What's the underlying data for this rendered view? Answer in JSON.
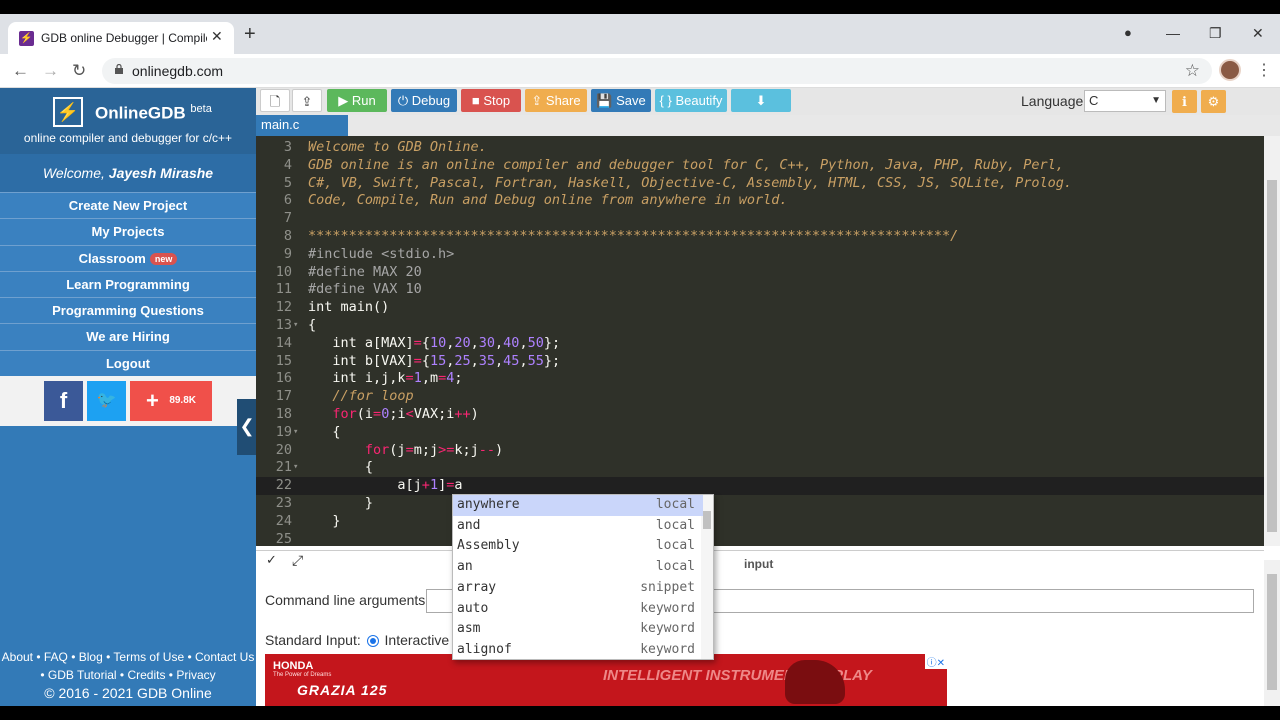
{
  "browser": {
    "tab_title": "GDB online Debugger | Compiler - Code, Compile, Run, Debug online C, C++",
    "tab_favicon": "⚡",
    "tab_close": "✕",
    "new_tab": "+",
    "url": "onlinegdb.com",
    "nav": {
      "back": "←",
      "forward": "→",
      "reload": "↻"
    },
    "window": {
      "profile": "●",
      "minimize": "—",
      "restore": "❐",
      "close": "✕"
    },
    "bookmark": "☆",
    "menu": "⋮"
  },
  "sidebar": {
    "logo_icon": "⚡",
    "brand": "OnlineGDB",
    "beta": "beta",
    "tagline": "online compiler and debugger for c/c++",
    "welcome_prefix": "Welcome, ",
    "user": "Jayesh Mirashe",
    "items": [
      {
        "label": "Create New Project"
      },
      {
        "label": "My Projects"
      },
      {
        "label": "Classroom",
        "badge": "new"
      },
      {
        "label": "Learn Programming"
      },
      {
        "label": "Programming Questions"
      },
      {
        "label": "We are Hiring"
      },
      {
        "label": "Logout"
      }
    ],
    "social": {
      "facebook": "f",
      "twitter": "🐦",
      "share_plus": "+",
      "share_count": "89.8K"
    },
    "footer_line1": "About • FAQ • Blog • Terms of Use • Contact Us",
    "footer_line2": "• GDB Tutorial • Credits • Privacy",
    "footer_copy": "© 2016 - 2021 GDB Online",
    "collapse": "❮"
  },
  "toolbar": {
    "new_file": "🗋",
    "upload": "⇪",
    "run": "▶ Run",
    "debug": "⏻ Debug",
    "stop": "■ Stop",
    "share": "⇪ Share",
    "save": "💾 Save",
    "beautify": "{ } Beautify",
    "download": "⬇",
    "language_label": "Language",
    "language_value": "C",
    "info": "ℹ",
    "settings": "⚙",
    "colors": {
      "run": "#5cb85c",
      "debug": "#337ab7",
      "stop": "#d9534f",
      "share": "#f0ad4e",
      "save": "#337ab7",
      "beautify": "#5bc0de",
      "download": "#5bc0de"
    }
  },
  "file_tab": "main.c",
  "editor": {
    "lines": [
      {
        "n": "3",
        "html": "<span class='c'>Welcome to GDB Online.</span>"
      },
      {
        "n": "4",
        "html": "<span class='c'>GDB online is an online compiler and debugger tool for C, C++, Python, Java, PHP, Ruby, Perl,</span>"
      },
      {
        "n": "5",
        "html": "<span class='c'>C#, VB, Swift, Pascal, Fortran, Haskell, Objective-C, Assembly, HTML, CSS, JS, SQLite, Prolog.</span>"
      },
      {
        "n": "6",
        "html": "<span class='c'>Code, Compile, Run and Debug online from anywhere in world.</span>"
      },
      {
        "n": "7",
        "html": ""
      },
      {
        "n": "8",
        "html": "<span class='c'>*******************************************************************************/</span>"
      },
      {
        "n": "9",
        "html": "<span class='pp'>#include &lt;stdio.h&gt;</span>"
      },
      {
        "n": "10",
        "html": "<span class='pp'>#define MAX 20</span>"
      },
      {
        "n": "11",
        "html": "<span class='pp'>#define VAX 10</span>"
      },
      {
        "n": "12",
        "html": "int main()"
      },
      {
        "n": "13",
        "fold": true,
        "html": "{"
      },
      {
        "n": "14",
        "html": "   int a[MAX]<span class='op'>=</span>{<span class='n'>10</span>,<span class='n'>20</span>,<span class='n'>30</span>,<span class='n'>40</span>,<span class='n'>50</span>};"
      },
      {
        "n": "15",
        "html": "   int b[VAX]<span class='op'>=</span>{<span class='n'>15</span>,<span class='n'>25</span>,<span class='n'>35</span>,<span class='n'>45</span>,<span class='n'>55</span>};"
      },
      {
        "n": "16",
        "html": "   int i,j,k<span class='op'>=</span><span class='n'>1</span>,m<span class='op'>=</span><span class='n'>4</span>;"
      },
      {
        "n": "17",
        "html": "   <span class='c'>//for loop</span>"
      },
      {
        "n": "18",
        "html": "   <span class='loopkw'>for</span>(i<span class='op'>=</span><span class='n'>0</span>;i<span class='op'>&lt;</span>VAX;i<span class='op'>++</span>)"
      },
      {
        "n": "19",
        "fold": true,
        "html": "   {"
      },
      {
        "n": "20",
        "html": "       <span class='loopkw'>for</span>(j<span class='op'>=</span>m;j<span class='op'>&gt;=</span>k;j<span class='op'>--</span>)"
      },
      {
        "n": "21",
        "fold": true,
        "html": "       {"
      },
      {
        "n": "22",
        "active": true,
        "html": "           a[j<span class='op'>+</span><span class='n'>1</span>]<span class='op'>=</span>a"
      },
      {
        "n": "23",
        "html": "       }"
      },
      {
        "n": "24",
        "html": "   }"
      },
      {
        "n": "25",
        "html": ""
      }
    ]
  },
  "autocomplete": [
    {
      "word": "anywhere",
      "meta": "local",
      "selected": true
    },
    {
      "word": "and",
      "meta": "local"
    },
    {
      "word": "Assembly",
      "meta": "local"
    },
    {
      "word": "an",
      "meta": "local"
    },
    {
      "word": "array",
      "meta": "snippet"
    },
    {
      "word": "auto",
      "meta": "keyword"
    },
    {
      "word": "asm",
      "meta": "keyword"
    },
    {
      "word": "alignof",
      "meta": "keyword"
    }
  ],
  "bottom": {
    "collapse_icon": "✓",
    "expand_icon": "⤢",
    "input_tab": "input",
    "cla_label": "Command line arguments:",
    "stdin_label": "Standard Input:",
    "stdin_option": "Interactive Co",
    "ad_brand": "HONDA",
    "ad_tagline": "The Power of Dreams",
    "ad_model": "GRAZIA 125",
    "ad_headline": "INTELLIGENT INSTRUMENT DISPLAY",
    "ad_choices": "ⓘ✕"
  }
}
